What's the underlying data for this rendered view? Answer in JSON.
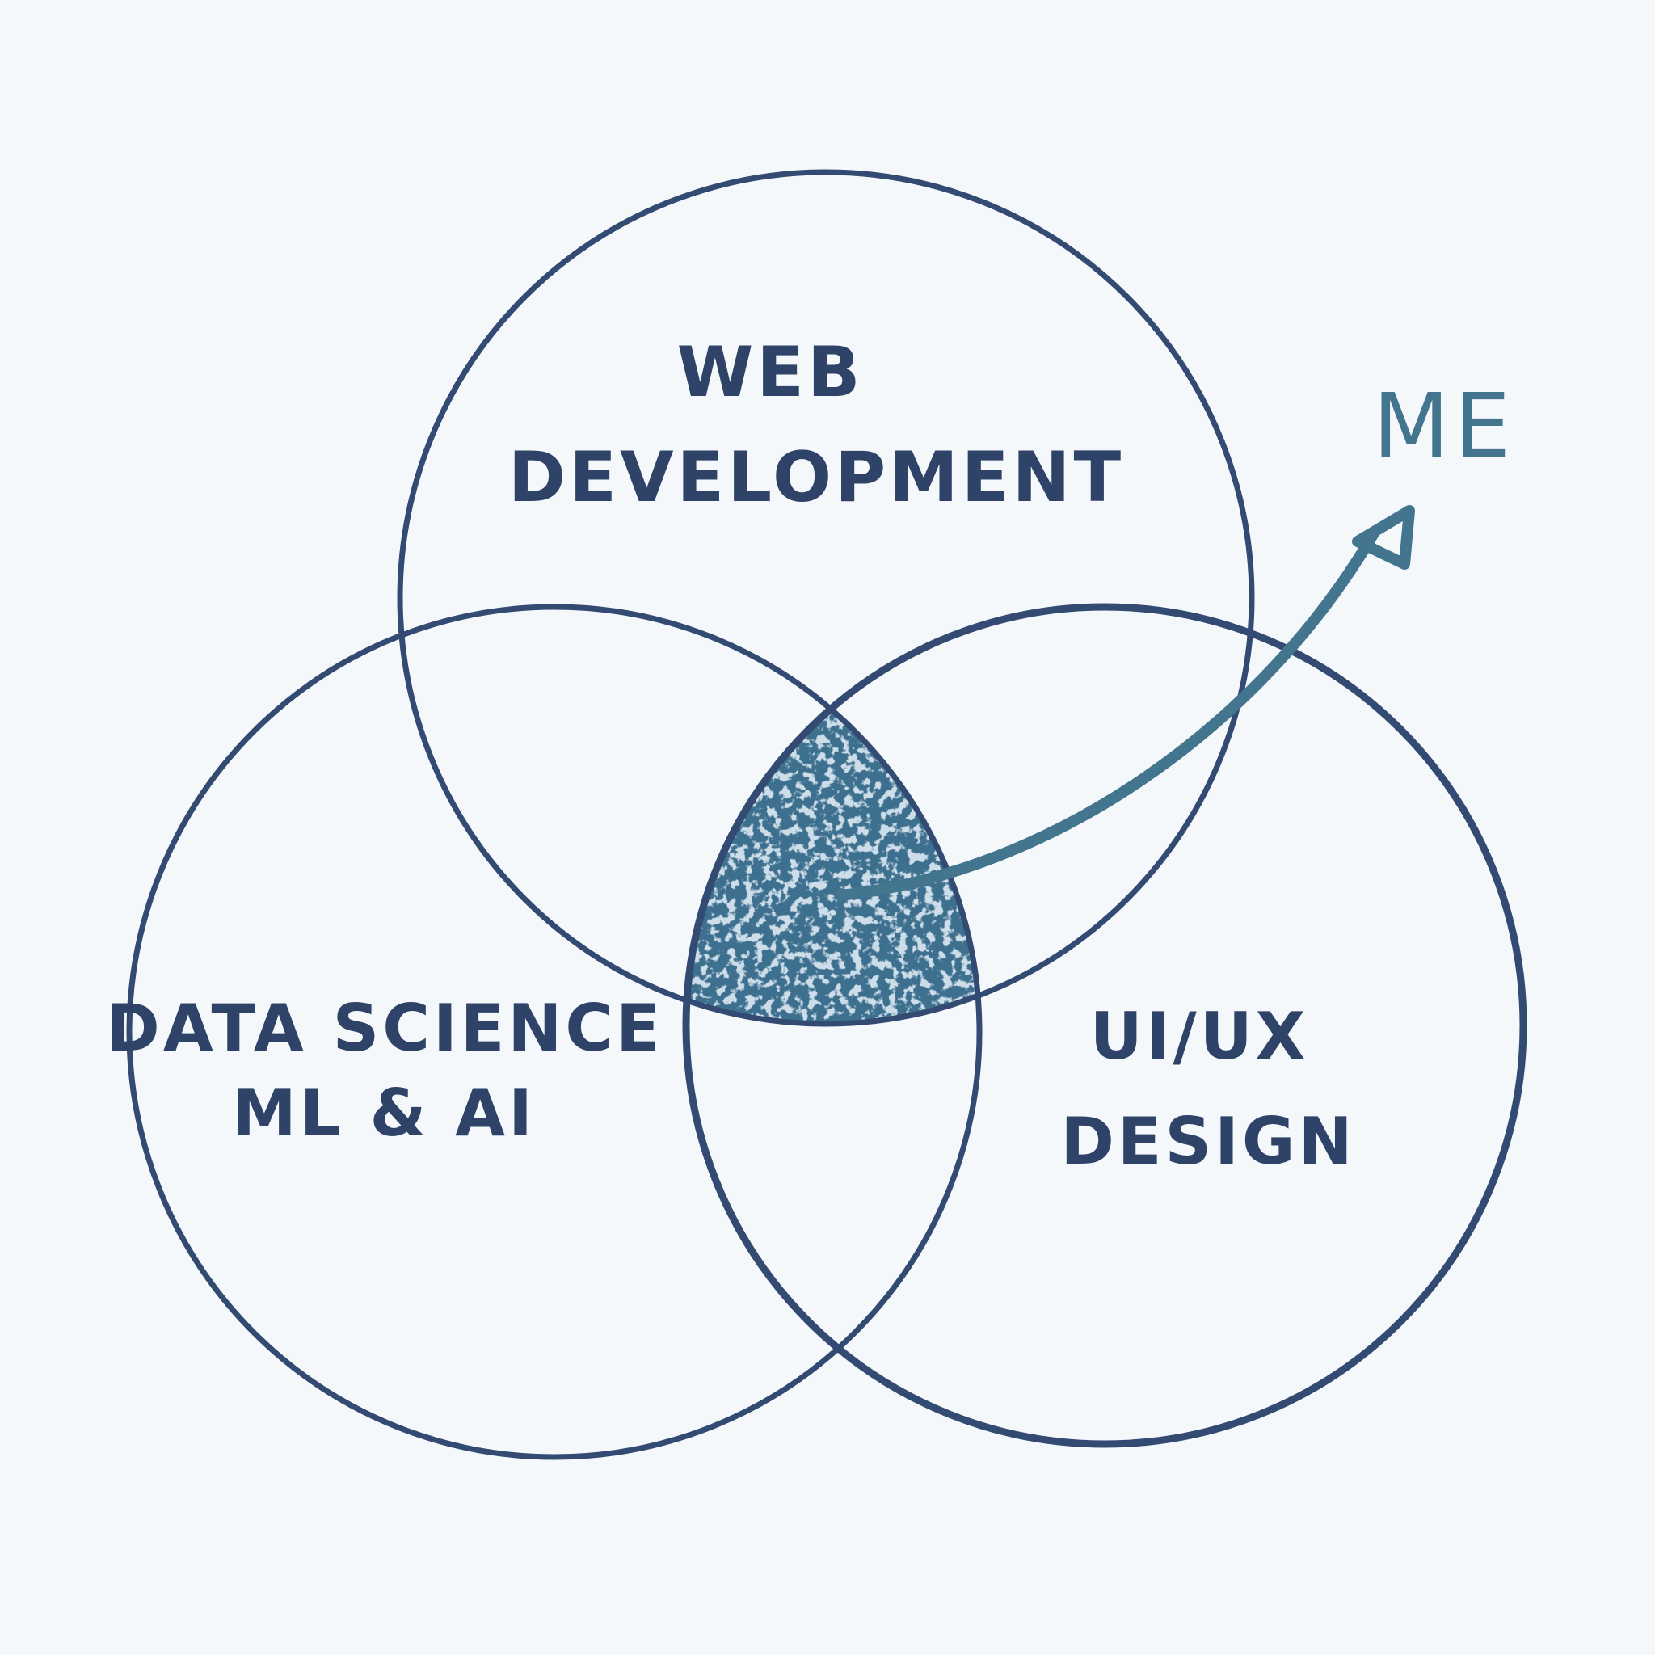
{
  "colors": {
    "background": "#f4f8fa",
    "circle_stroke": "#334a72",
    "label_text": "#2f4368",
    "highlight_fill": "#3d6f8e",
    "highlight_speckle": "#9bbad0",
    "arrow": "#44758f"
  },
  "diagram": {
    "type": "venn-3",
    "sets": [
      {
        "id": "web",
        "lines": [
          "WEB",
          "DEVELOPMENT"
        ]
      },
      {
        "id": "data",
        "lines": [
          "DATA SCIENCE",
          "ML & AI"
        ]
      },
      {
        "id": "design",
        "lines": [
          "UI/UX",
          "DESIGN"
        ]
      }
    ],
    "highlighted_region": "web ∩ data ∩ design",
    "pointer": {
      "label": "ME",
      "icon": "curved-arrow-icon"
    }
  }
}
